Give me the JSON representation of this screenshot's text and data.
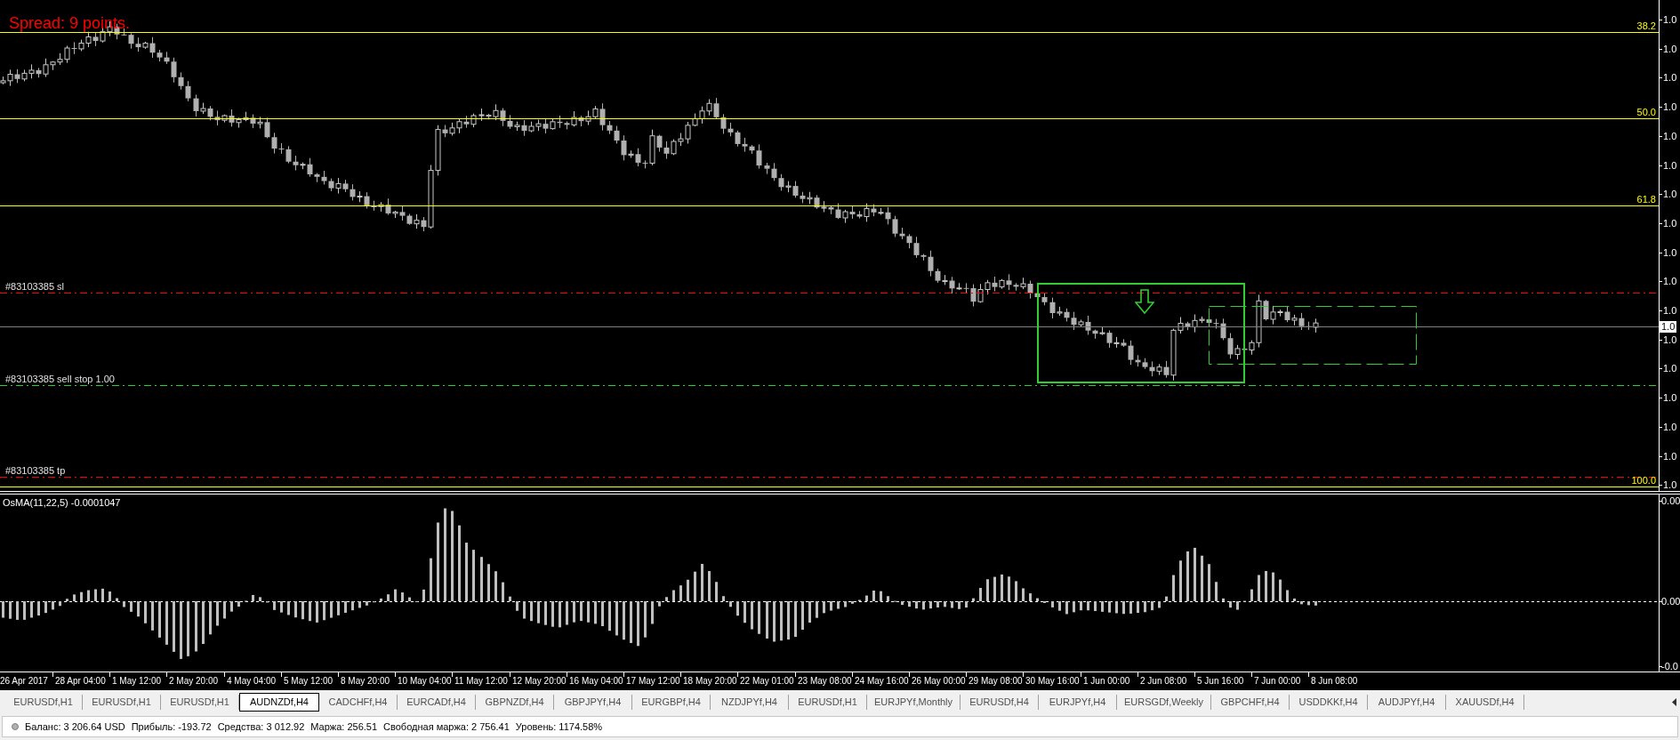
{
  "chart": {
    "spread_label": "Spread: 9 points.",
    "fibonacci_levels": [
      {
        "label": "38.2"
      },
      {
        "label": "50.0"
      },
      {
        "label": "61.8"
      },
      {
        "label": "100.0"
      }
    ],
    "order_lines": [
      {
        "kind": "stop_loss",
        "label": "#83103385 sl"
      },
      {
        "kind": "sell_stop",
        "label": "#83103385 sell stop 1.00"
      },
      {
        "kind": "take_profit",
        "label": "#83103385 tp"
      }
    ],
    "price_axis": {
      "labels": [
        "1.0",
        "1.0",
        "1.0",
        "1.0",
        "1.0",
        "1.0",
        "1.0",
        "1.0",
        "1.0",
        "1.0",
        "1.0",
        "1.0",
        "1.0",
        "1.0",
        "1.0",
        "1.0",
        "1.0"
      ],
      "current_price": "1.0"
    }
  },
  "indicator": {
    "label": "OsMA(11,22,5) -0.0001047",
    "axis_labels": [
      "0.00",
      "0.00",
      "-0.0"
    ]
  },
  "time_axis": {
    "labels": [
      "26 Apr 2017",
      "28 Apr 04:00",
      "1 May 12:00",
      "2 May 20:00",
      "4 May 04:00",
      "5 May 12:00",
      "8 May 20:00",
      "10 May 04:00",
      "11 May 12:00",
      "12 May 20:00",
      "16 May 04:00",
      "17 May 12:00",
      "18 May 20:00",
      "22 May 01:00",
      "23 May 08:00",
      "24 May 16:00",
      "26 May 00:00",
      "29 May 08:00",
      "30 May 16:00",
      "1 Jun 00:00",
      "2 Jun 08:00",
      "5 Jun 16:00",
      "7 Jun 00:00",
      "8 Jun 08:00"
    ]
  },
  "tabs": [
    {
      "label": "EURUSDf,H1",
      "selected": false
    },
    {
      "label": "EURUSDf,H1",
      "selected": false
    },
    {
      "label": "EURUSDf,H1",
      "selected": false
    },
    {
      "label": "AUDNZDf,H4",
      "selected": true
    },
    {
      "label": "CADCHFf,H4",
      "selected": false
    },
    {
      "label": "EURCADf,H4",
      "selected": false
    },
    {
      "label": "GBPNZDf,H4",
      "selected": false
    },
    {
      "label": "GBPJPYf,H4",
      "selected": false
    },
    {
      "label": "EURGBPf,H4",
      "selected": false
    },
    {
      "label": "NZDJPYf,H4",
      "selected": false
    },
    {
      "label": "EURUSDf,H1",
      "selected": false
    },
    {
      "label": "EURJPYf,Monthly",
      "selected": false
    },
    {
      "label": "EURUSDf,H4",
      "selected": false
    },
    {
      "label": "EURJPYf,H4",
      "selected": false
    },
    {
      "label": "EURSGDf,Weekly",
      "selected": false
    },
    {
      "label": "GBPCHFf,H4",
      "selected": false
    },
    {
      "label": "USDDKKf,H4",
      "selected": false
    },
    {
      "label": "AUDJPYf,H4",
      "selected": false
    },
    {
      "label": "XAUUSDf,H4",
      "selected": false
    }
  ],
  "status_bar": {
    "items": [
      "Баланс: 3 206.64 USD",
      "Прибыль: -193.72",
      "Средства: 3 012.92",
      "Маржа: 256.51",
      "Свободная маржа: 2 756.41",
      "Уровень: 1174.58%"
    ]
  }
}
